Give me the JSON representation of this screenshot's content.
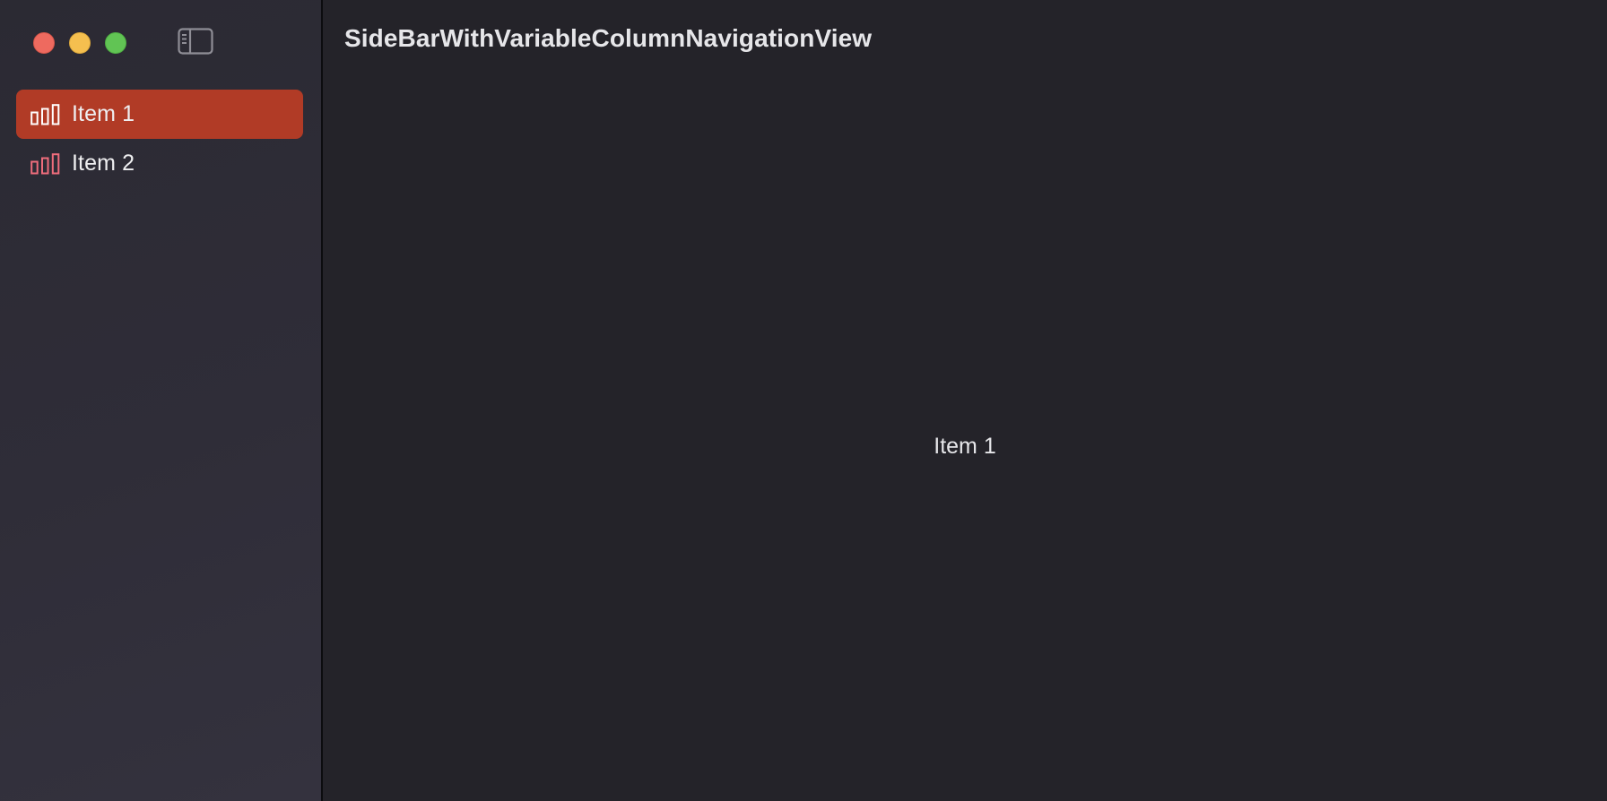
{
  "window": {
    "title": "SideBarWithVariableColumnNavigationView",
    "traffic_lights": [
      {
        "name": "close",
        "color": "#ee6a5f"
      },
      {
        "name": "minimize",
        "color": "#f5bf4f"
      },
      {
        "name": "zoom",
        "color": "#61c454"
      }
    ]
  },
  "toolbar": {
    "sidebar_toggle_icon": "sidebar-left-icon"
  },
  "sidebar": {
    "selected_color": "#b13b26",
    "items": [
      {
        "label": "Item 1",
        "icon": "chart-bar-icon",
        "selected": true
      },
      {
        "label": "Item 2",
        "icon": "chart-bar-icon",
        "selected": false
      }
    ]
  },
  "detail": {
    "text": "Item 1"
  }
}
